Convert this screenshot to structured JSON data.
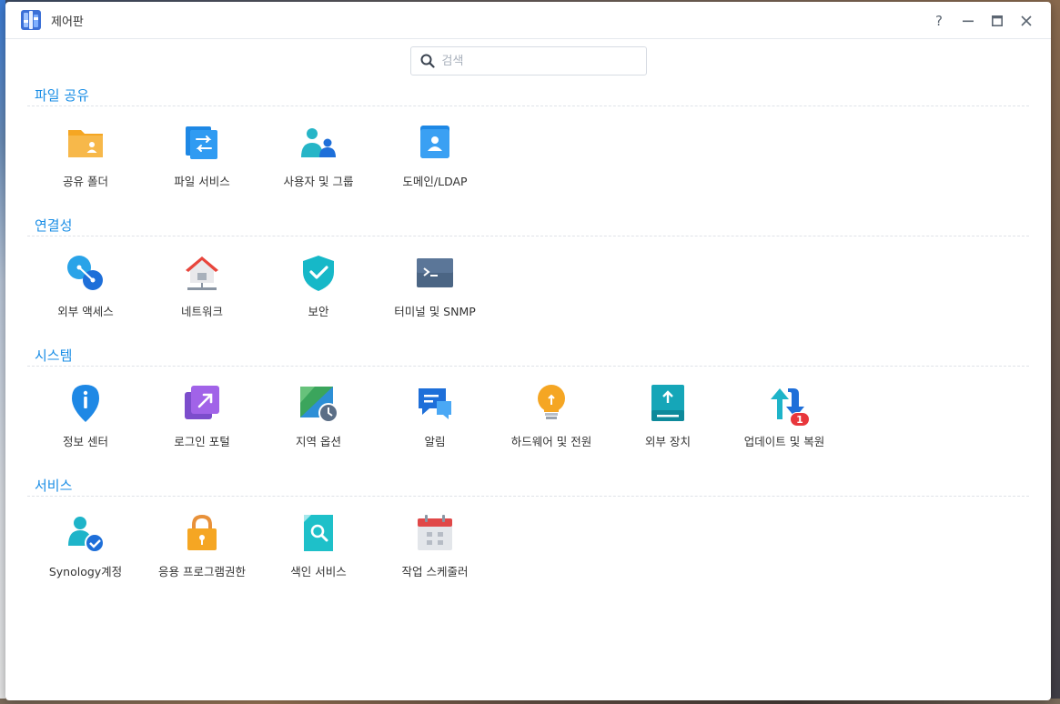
{
  "window": {
    "title": "제어판",
    "controls": {
      "help": "?"
    }
  },
  "search": {
    "placeholder": "검색",
    "value": ""
  },
  "sections": [
    {
      "title": "파일 공유",
      "items": [
        {
          "label": "공유 폴더",
          "icon": "shared-folder-icon"
        },
        {
          "label": "파일 서비스",
          "icon": "file-services-icon"
        },
        {
          "label": "사용자 및 그룹",
          "icon": "user-group-icon"
        },
        {
          "label": "도메인/LDAP",
          "icon": "domain-ldap-icon"
        }
      ]
    },
    {
      "title": "연결성",
      "items": [
        {
          "label": "외부 액세스",
          "icon": "external-access-icon"
        },
        {
          "label": "네트워크",
          "icon": "network-icon"
        },
        {
          "label": "보안",
          "icon": "security-shield-icon"
        },
        {
          "label": "터미널 및 SNMP",
          "icon": "terminal-icon"
        }
      ]
    },
    {
      "title": "시스템",
      "items": [
        {
          "label": "정보 센터",
          "icon": "info-center-icon"
        },
        {
          "label": "로그인 포털",
          "icon": "login-portal-icon"
        },
        {
          "label": "지역 옵션",
          "icon": "regional-options-icon"
        },
        {
          "label": "알림",
          "icon": "notification-icon"
        },
        {
          "label": "하드웨어 및 전원",
          "icon": "hardware-power-icon"
        },
        {
          "label": "외부 장치",
          "icon": "external-devices-icon"
        },
        {
          "label": "업데이트 및 복원",
          "icon": "update-restore-icon",
          "badge": "1"
        }
      ]
    },
    {
      "title": "서비스",
      "items": [
        {
          "label": "Synology계정",
          "icon": "synology-account-icon"
        },
        {
          "label": "응용 프로그램권한",
          "icon": "application-privileges-icon"
        },
        {
          "label": "색인 서비스",
          "icon": "indexing-service-icon"
        },
        {
          "label": "작업 스케줄러",
          "icon": "task-scheduler-icon"
        }
      ]
    }
  ],
  "colors": {
    "accent": "#1a8ee6",
    "badge": "#e8373c"
  }
}
